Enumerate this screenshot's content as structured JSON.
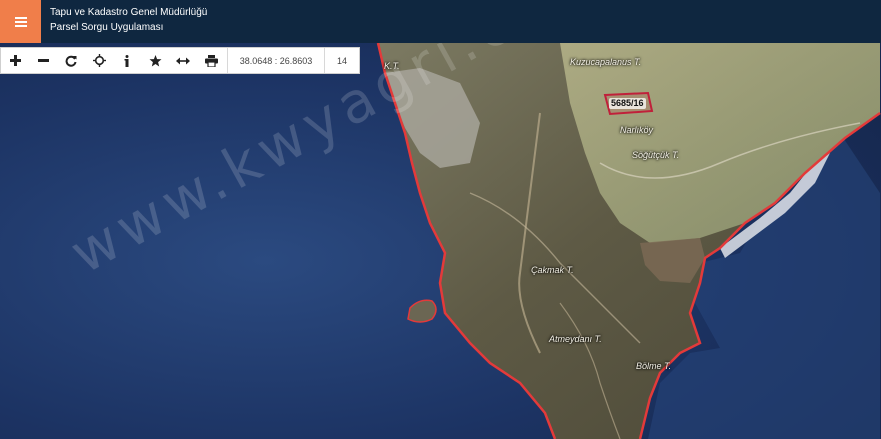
{
  "header": {
    "title": "Tapu ve Kadastro Genel Müdürlüğü",
    "subtitle": "Parsel Sorgu Uygulaması",
    "menu_icon": "hamburger-menu-icon",
    "background_color": "#0f2740",
    "accent_color": "#f07e4a"
  },
  "toolbar": {
    "tools": [
      {
        "name": "zoom-in",
        "icon": "plus-icon"
      },
      {
        "name": "zoom-out",
        "icon": "minus-icon"
      },
      {
        "name": "refresh",
        "icon": "refresh-icon"
      },
      {
        "name": "locate",
        "icon": "crosshair-icon"
      },
      {
        "name": "info",
        "icon": "info-icon"
      },
      {
        "name": "favorite",
        "icon": "star-icon"
      },
      {
        "name": "measure",
        "icon": "arrows-horizontal-icon"
      },
      {
        "name": "print",
        "icon": "printer-icon"
      }
    ],
    "coordinates": "38.0648 : 26.8603",
    "zoom_level": "14"
  },
  "map": {
    "labels": {
      "kot": "K.T.",
      "kuzu": "Kuzucapalanus T.",
      "narlikoy": "Narlıköy",
      "sogutcuk": "Söğütçük T.",
      "cakmak": "Çakmak T.",
      "atmeydani": "Atmeydanı T.",
      "bolme": "Bölme T."
    },
    "parcel_label": "5685/16",
    "parcel_color": "#c0203a",
    "coastline_color": "#e33a3a",
    "sea_color": "#1b2f5a"
  },
  "watermark": "www.kwyagri.com"
}
